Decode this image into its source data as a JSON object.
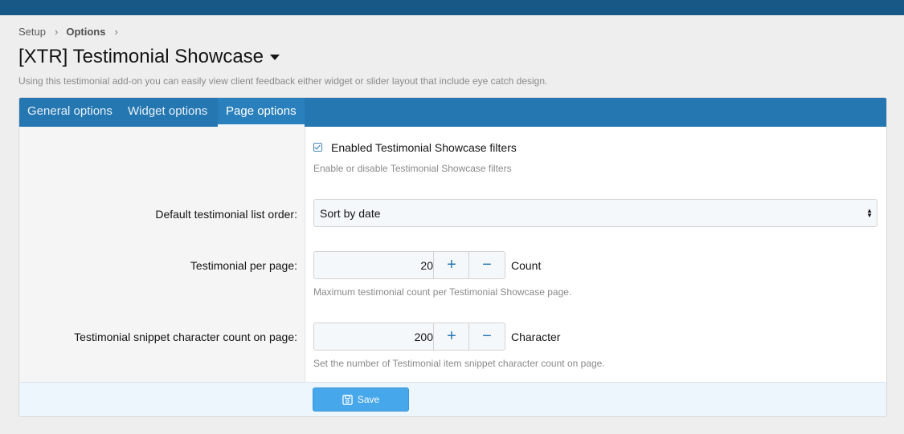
{
  "breadcrumb": {
    "items": [
      "Setup",
      "Options"
    ],
    "separator": "›"
  },
  "page": {
    "title": "[XTR] Testimonial Showcase",
    "description": "Using this testimonial add-on you can easily view client feedback either widget or slider layout that include eye catch design."
  },
  "tabs": [
    {
      "label": "General options",
      "active": false
    },
    {
      "label": "Widget options",
      "active": false
    },
    {
      "label": "Page options",
      "active": true
    }
  ],
  "form": {
    "filters": {
      "label": "Enabled Testimonial Showcase filters",
      "checked": true,
      "hint": "Enable or disable Testimonial Showcase filters"
    },
    "order": {
      "label": "Default testimonial list order:",
      "value": "Sort by date"
    },
    "per_page": {
      "label": "Testimonial per page:",
      "value": "20",
      "unit": "Count",
      "hint": "Maximum testimonial count per Testimonial Showcase page."
    },
    "snippet": {
      "label": "Testimonial snippet character count on page:",
      "value": "200",
      "unit": "Character",
      "hint": "Set the number of Testimonial item snippet character count on page."
    },
    "stepper": {
      "plus": "+",
      "minus": "−"
    }
  },
  "footer": {
    "save_label": "Save",
    "save_icon": "floppy-disk-icon"
  },
  "colors": {
    "accent": "#2577b1",
    "topbar": "#185886",
    "button": "#47a7eb"
  }
}
